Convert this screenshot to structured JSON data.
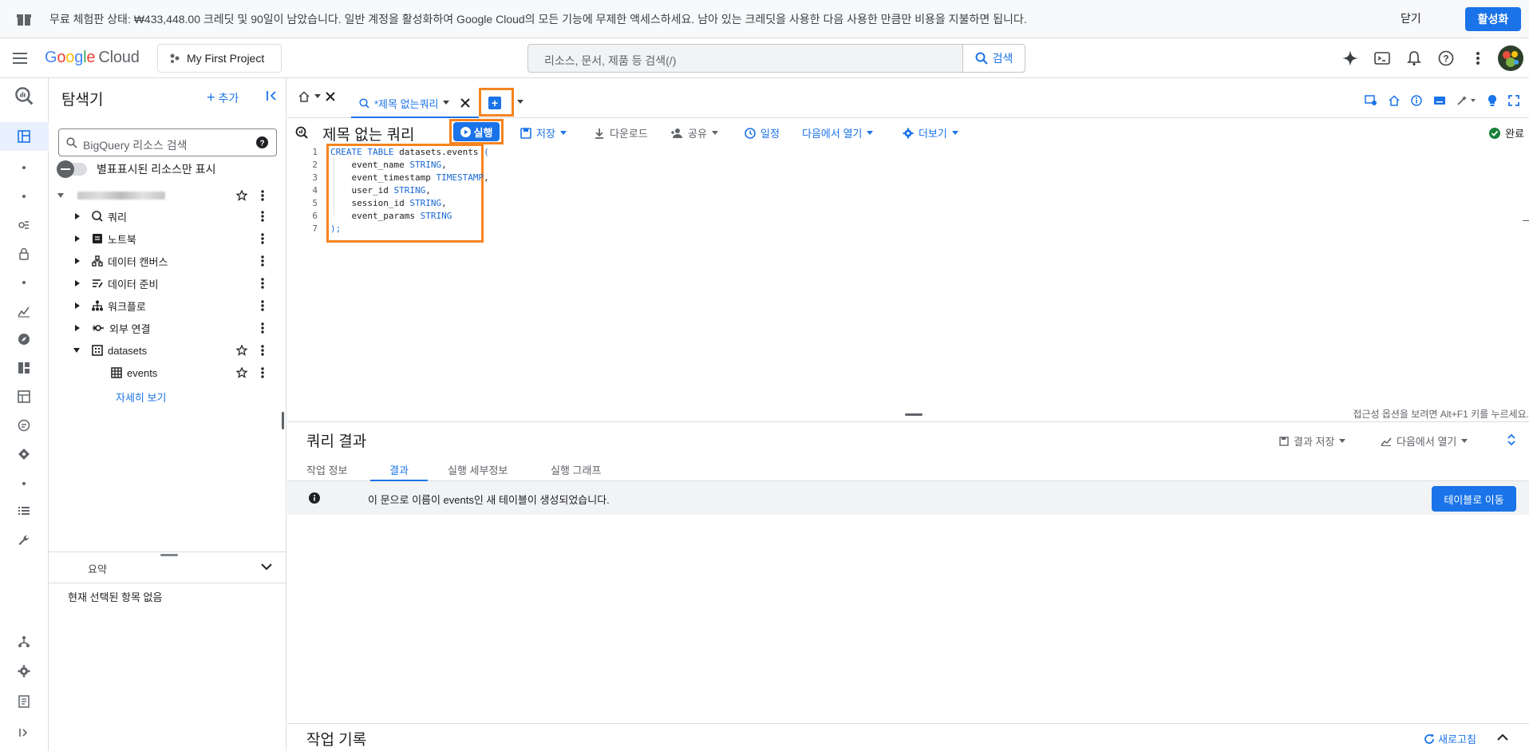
{
  "banner": {
    "text": "무료 체험판 상태: ₩433,448.00 크레딧 및 90일이 남았습니다. 일반 계정을 활성화하여 Google Cloud의 모든 기능에 무제한 액세스하세요. 남아 있는 크레딧을 사용한 다음 사용한 만큼만 비용을 지불하면 됩니다.",
    "close_label": "닫기",
    "activate_label": "활성화"
  },
  "header": {
    "logo_google": [
      "G",
      "o",
      "o",
      "g",
      "l",
      "e"
    ],
    "logo_cloud": "Cloud",
    "project_label": "My First Project",
    "search_placeholder": "리소스, 문서, 제품 등 검색(/)",
    "search_button": "검색"
  },
  "explorer": {
    "title": "탐색기",
    "add_label": "추가",
    "search_placeholder": "BigQuery 리소스 검색",
    "starred_only_label": "별표표시된 리소스만 표시",
    "tree": [
      {
        "label": "쿼리",
        "icon": "query-icon"
      },
      {
        "label": "노트북",
        "icon": "notebook-icon"
      },
      {
        "label": "데이터 캔버스",
        "icon": "canvas-icon"
      },
      {
        "label": "데이터 준비",
        "icon": "data-prep-icon"
      },
      {
        "label": "워크플로",
        "icon": "workflow-icon"
      },
      {
        "label": "외부 연결",
        "icon": "connection-icon"
      },
      {
        "label": "datasets",
        "icon": "dataset-icon"
      },
      {
        "label": "events",
        "icon": "table-icon"
      }
    ],
    "more_link": "자세히 보기",
    "summary_label": "요약",
    "summary_empty": "현재 선택된 항목 없음"
  },
  "tabs": {
    "query_tab_label": "*제목 없는쿼리"
  },
  "query": {
    "title": "제목 없는 쿼리",
    "run_label": "실행",
    "save_label": "저장",
    "download_label": "다운로드",
    "share_label": "공유",
    "schedule_label": "일정",
    "open_in_label": "다음에서 열기",
    "more_label": "더보기",
    "status_label": "완료",
    "line_numbers": [
      "1",
      "2",
      "3",
      "4",
      "5",
      "6",
      "7"
    ],
    "code": {
      "l1_kw": "CREATE TABLE",
      "l1_name": " datasets.events ",
      "l1_paren": "(",
      "l2_name": "    event_name ",
      "l2_type": "STRING",
      "l3_name": "    event_timestamp ",
      "l3_type": "TIMESTAMP",
      "l4_name": "    user_id ",
      "l4_type": "STRING",
      "l5_name": "    session_id ",
      "l5_type": "STRING",
      "l6_name": "    event_params ",
      "l6_type": "STRING",
      "l7": ");",
      "comma": ","
    },
    "a11y_hint": "접근성 옵션을 보려면 Alt+F1 키를 누르세요."
  },
  "results": {
    "title": "쿼리 결과",
    "save_results_label": "결과 저장",
    "open_in_label": "다음에서 열기",
    "tabs": [
      "작업 정보",
      "결과",
      "실행 세부정보",
      "실행 그래프"
    ],
    "active_tab_index": 1,
    "message": "이 문으로 이름이 events인 새 테이블이 생성되었습니다.",
    "goto_table_label": "테이블로 이동"
  },
  "history": {
    "title": "작업 기록",
    "refresh_label": "새로고침"
  },
  "colors": {
    "accent": "#1a73e8",
    "highlight": "#f5841f"
  }
}
